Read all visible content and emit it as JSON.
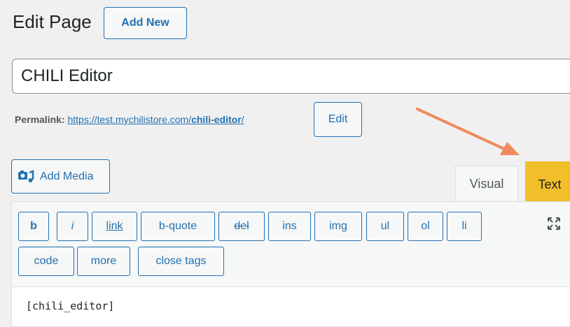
{
  "header": {
    "title": "Edit Page",
    "add_new": "Add New"
  },
  "post_title": "CHILI Editor",
  "permalink": {
    "label": "Permalink:",
    "url_base": "https://test.mychilistore.com/",
    "slug": "chili-editor",
    "slash": "/",
    "edit_label": "Edit"
  },
  "media": {
    "add_media": "Add Media"
  },
  "tabs": {
    "visual": "Visual",
    "text": "Text"
  },
  "toolbar": {
    "buttons": [
      "b",
      "i",
      "link",
      "b-quote",
      "del",
      "ins",
      "img",
      "ul",
      "ol",
      "li",
      "code",
      "more",
      "close tags"
    ]
  },
  "content": "[chili_editor]",
  "colors": {
    "accent": "#2271b1",
    "highlight": "#f0bf2a",
    "arrow": "#f08a5d"
  }
}
